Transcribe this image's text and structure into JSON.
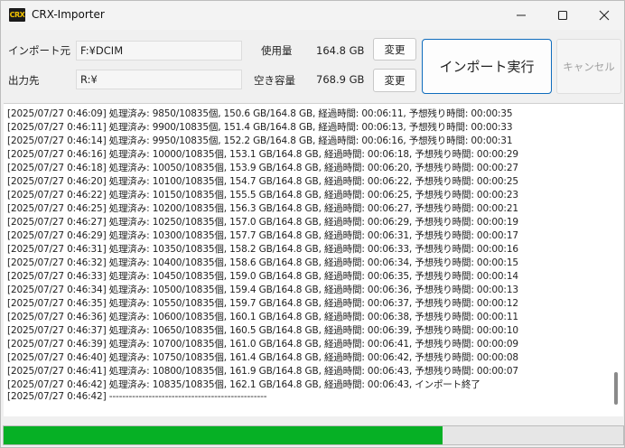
{
  "window": {
    "icon_label": "CRX",
    "title": "CRX-Importer"
  },
  "form": {
    "import_source_label": "インポート元",
    "import_source_value": "F:¥DCIM",
    "output_label": "出力先",
    "output_value": "R:¥",
    "used_label": "使用量",
    "used_value": "164.8 GB",
    "free_label": "空き容量",
    "free_value": "768.9 GB",
    "change_label_1": "変更",
    "change_label_2": "変更",
    "run_label": "インポート実行",
    "cancel_label": "キャンセル"
  },
  "log": {
    "lines": [
      "[2025/07/27 0:46:09] 処理済み: 9850/10835個, 150.6 GB/164.8 GB, 経過時間: 00:06:11, 予想残り時間: 00:00:35",
      "[2025/07/27 0:46:11] 処理済み: 9900/10835個, 151.4 GB/164.8 GB, 経過時間: 00:06:13, 予想残り時間: 00:00:33",
      "[2025/07/27 0:46:14] 処理済み: 9950/10835個, 152.2 GB/164.8 GB, 経過時間: 00:06:16, 予想残り時間: 00:00:31",
      "[2025/07/27 0:46:16] 処理済み: 10000/10835個, 153.1 GB/164.8 GB, 経過時間: 00:06:18, 予想残り時間: 00:00:29",
      "[2025/07/27 0:46:18] 処理済み: 10050/10835個, 153.9 GB/164.8 GB, 経過時間: 00:06:20, 予想残り時間: 00:00:27",
      "[2025/07/27 0:46:20] 処理済み: 10100/10835個, 154.7 GB/164.8 GB, 経過時間: 00:06:22, 予想残り時間: 00:00:25",
      "[2025/07/27 0:46:22] 処理済み: 10150/10835個, 155.5 GB/164.8 GB, 経過時間: 00:06:25, 予想残り時間: 00:00:23",
      "[2025/07/27 0:46:25] 処理済み: 10200/10835個, 156.3 GB/164.8 GB, 経過時間: 00:06:27, 予想残り時間: 00:00:21",
      "[2025/07/27 0:46:27] 処理済み: 10250/10835個, 157.0 GB/164.8 GB, 経過時間: 00:06:29, 予想残り時間: 00:00:19",
      "[2025/07/27 0:46:29] 処理済み: 10300/10835個, 157.7 GB/164.8 GB, 経過時間: 00:06:31, 予想残り時間: 00:00:17",
      "[2025/07/27 0:46:31] 処理済み: 10350/10835個, 158.2 GB/164.8 GB, 経過時間: 00:06:33, 予想残り時間: 00:00:16",
      "[2025/07/27 0:46:32] 処理済み: 10400/10835個, 158.6 GB/164.8 GB, 経過時間: 00:06:34, 予想残り時間: 00:00:15",
      "[2025/07/27 0:46:33] 処理済み: 10450/10835個, 159.0 GB/164.8 GB, 経過時間: 00:06:35, 予想残り時間: 00:00:14",
      "[2025/07/27 0:46:34] 処理済み: 10500/10835個, 159.4 GB/164.8 GB, 経過時間: 00:06:36, 予想残り時間: 00:00:13",
      "[2025/07/27 0:46:35] 処理済み: 10550/10835個, 159.7 GB/164.8 GB, 経過時間: 00:06:37, 予想残り時間: 00:00:12",
      "[2025/07/27 0:46:36] 処理済み: 10600/10835個, 160.1 GB/164.8 GB, 経過時間: 00:06:38, 予想残り時間: 00:00:11",
      "[2025/07/27 0:46:37] 処理済み: 10650/10835個, 160.5 GB/164.8 GB, 経過時間: 00:06:39, 予想残り時間: 00:00:10",
      "[2025/07/27 0:46:39] 処理済み: 10700/10835個, 161.0 GB/164.8 GB, 経過時間: 00:06:41, 予想残り時間: 00:00:09",
      "[2025/07/27 0:46:40] 処理済み: 10750/10835個, 161.4 GB/164.8 GB, 経過時間: 00:06:42, 予想残り時間: 00:00:08",
      "[2025/07/27 0:46:41] 処理済み: 10800/10835個, 161.9 GB/164.8 GB, 経過時間: 00:06:43, 予想残り時間: 00:00:07",
      "[2025/07/27 0:46:42] 処理済み: 10835/10835個, 162.1 GB/164.8 GB, 経過時間: 00:06:43, インポート終了",
      "[2025/07/27 0:46:42] ------------------------------------------------"
    ]
  },
  "progress": {
    "fraction": 0.708,
    "fill_color": "#06b025"
  },
  "icons": {
    "minimize": "minimize-icon",
    "maximize": "maximize-icon",
    "close": "close-icon"
  }
}
